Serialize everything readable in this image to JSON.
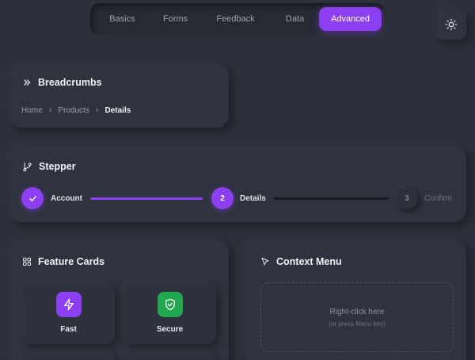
{
  "nav": {
    "tabs": [
      {
        "label": "Basics",
        "active": false
      },
      {
        "label": "Forms",
        "active": false
      },
      {
        "label": "Feedback",
        "active": false
      },
      {
        "label": "Data",
        "active": false
      },
      {
        "label": "Advanced",
        "active": true
      }
    ]
  },
  "theme_toggle": {
    "icon": "sun-icon"
  },
  "breadcrumbs": {
    "title": "Breadcrumbs",
    "icon": "double-chevron-right-icon",
    "items": [
      "Home",
      "Products",
      "Details"
    ]
  },
  "stepper": {
    "title": "Stepper",
    "icon": "git-branch-icon",
    "steps": [
      {
        "label": "Account",
        "state": "done",
        "number": "1"
      },
      {
        "label": "Details",
        "state": "current",
        "number": "2"
      },
      {
        "label": "Confirm",
        "state": "pending",
        "number": "3"
      }
    ]
  },
  "feature_cards": {
    "title": "Feature Cards",
    "icon": "grid-icon",
    "items": [
      {
        "label": "Fast",
        "icon": "lightning-icon",
        "color": "#8b3ff0"
      },
      {
        "label": "Secure",
        "icon": "shield-check-icon",
        "color": "#22a94f"
      }
    ]
  },
  "context_menu": {
    "title": "Context Menu",
    "icon": "cursor-icon",
    "hint": "Right-click here",
    "sub_hint": "(or press Menu key)"
  },
  "colors": {
    "accent": "#8b3ff0",
    "success": "#22a94f",
    "background": "#2b303a"
  }
}
